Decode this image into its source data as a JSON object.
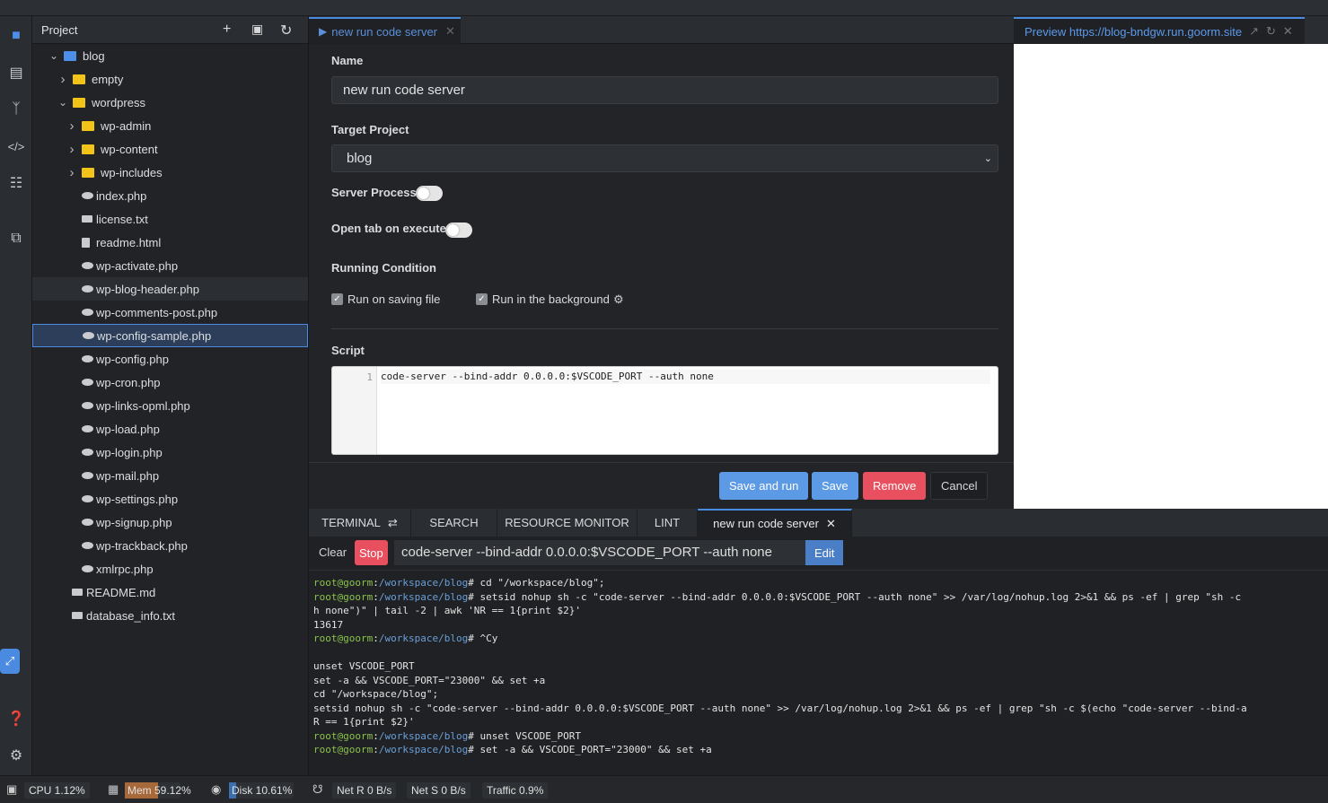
{
  "tree": {
    "title": "Project",
    "items": [
      {
        "label": "blog",
        "depth": 0,
        "type": "folder-root",
        "expanded": true
      },
      {
        "label": "empty",
        "depth": 1,
        "type": "folder",
        "expanded": false
      },
      {
        "label": "wordpress",
        "depth": 1,
        "type": "folder",
        "expanded": true
      },
      {
        "label": "wp-admin",
        "depth": 2,
        "type": "folder",
        "expanded": false
      },
      {
        "label": "wp-content",
        "depth": 2,
        "type": "folder",
        "expanded": false
      },
      {
        "label": "wp-includes",
        "depth": 2,
        "type": "folder",
        "expanded": false
      },
      {
        "label": "index.php",
        "depth": 2,
        "type": "php"
      },
      {
        "label": "license.txt",
        "depth": 2,
        "type": "txt"
      },
      {
        "label": "readme.html",
        "depth": 2,
        "type": "html"
      },
      {
        "label": "wp-activate.php",
        "depth": 2,
        "type": "php"
      },
      {
        "label": "wp-blog-header.php",
        "depth": 2,
        "type": "php",
        "state": "hover"
      },
      {
        "label": "wp-comments-post.php",
        "depth": 2,
        "type": "php"
      },
      {
        "label": "wp-config-sample.php",
        "depth": 2,
        "type": "php",
        "state": "selected"
      },
      {
        "label": "wp-config.php",
        "depth": 2,
        "type": "php"
      },
      {
        "label": "wp-cron.php",
        "depth": 2,
        "type": "php"
      },
      {
        "label": "wp-links-opml.php",
        "depth": 2,
        "type": "php"
      },
      {
        "label": "wp-load.php",
        "depth": 2,
        "type": "php"
      },
      {
        "label": "wp-login.php",
        "depth": 2,
        "type": "php"
      },
      {
        "label": "wp-mail.php",
        "depth": 2,
        "type": "php"
      },
      {
        "label": "wp-settings.php",
        "depth": 2,
        "type": "php"
      },
      {
        "label": "wp-signup.php",
        "depth": 2,
        "type": "php"
      },
      {
        "label": "wp-trackback.php",
        "depth": 2,
        "type": "php"
      },
      {
        "label": "xmlrpc.php",
        "depth": 2,
        "type": "php"
      },
      {
        "label": "README.md",
        "depth": 1,
        "type": "txt"
      },
      {
        "label": "database_info.txt",
        "depth": 1,
        "type": "txt"
      }
    ]
  },
  "editor_tab": {
    "label": "new run code server"
  },
  "form": {
    "name_label": "Name",
    "name_value": "new run code server",
    "target_label": "Target Project",
    "target_value": "blog",
    "server_process_label": "Server Process",
    "server_process_on": false,
    "open_tab_label": "Open tab on execute",
    "open_tab_on": false,
    "running_condition_label": "Running Condition",
    "run_on_saving": "Run on saving file",
    "run_background": "Run in the background",
    "script_label": "Script",
    "script_line_no": "1",
    "script_code": "code-server --bind-addr 0.0.0.0:$VSCODE_PORT --auth none",
    "save_and_run": "Save and run",
    "save": "Save",
    "remove": "Remove",
    "cancel": "Cancel"
  },
  "preview": {
    "label": "Preview https://blog-bndgw.run.goorm.site"
  },
  "bottom_tabs": [
    "TERMINAL",
    "SEARCH",
    "RESOURCE MONITOR",
    "LINT",
    "new run code server"
  ],
  "runbar": {
    "clear": "Clear",
    "stop": "Stop",
    "command": "code-server --bind-addr 0.0.0.0:$VSCODE_PORT --auth none",
    "edit": "Edit"
  },
  "terminal": {
    "prompt_user": "root@goorm",
    "prompt_path": "/workspace/blog",
    "lines": [
      {
        "p": true,
        "t": " cd \"/workspace/blog\";"
      },
      {
        "p": true,
        "t": " setsid nohup sh -c \"code-server --bind-addr 0.0.0.0:$VSCODE_PORT --auth none\" >> /var/log/nohup.log 2>&1 && ps -ef | grep \"sh -c"
      },
      {
        "p": false,
        "t": "h none\")\" | tail -2 | awk 'NR == 1{print $2}'"
      },
      {
        "p": false,
        "t": "13617"
      },
      {
        "p": true,
        "t": " ^Cy"
      },
      {
        "p": false,
        "t": ""
      },
      {
        "p": false,
        "t": "unset VSCODE_PORT"
      },
      {
        "p": false,
        "t": "set -a && VSCODE_PORT=\"23000\" && set +a"
      },
      {
        "p": false,
        "t": "cd \"/workspace/blog\";"
      },
      {
        "p": false,
        "t": "setsid nohup sh -c \"code-server --bind-addr 0.0.0.0:$VSCODE_PORT --auth none\" >> /var/log/nohup.log 2>&1 && ps -ef | grep \"sh -c $(echo \"code-server --bind-a"
      },
      {
        "p": false,
        "t": "R == 1{print $2}'"
      },
      {
        "p": true,
        "t": " unset VSCODE_PORT"
      },
      {
        "p": true,
        "t": " set -a && VSCODE_PORT=\"23000\" && set +a"
      }
    ]
  },
  "status": {
    "cpu": "CPU 1.12%",
    "mem": "Mem 59.12%",
    "mem_fraction": 0.5912,
    "disk": "Disk 10.61%",
    "disk_fraction": 0.1061,
    "net_r": "Net R 0 B/s",
    "net_s": "Net S 0 B/s",
    "traffic": "Traffic 0.9%"
  },
  "colors": {
    "accent": "#4a8ae0",
    "danger": "#e8505f",
    "primary": "#5c9ae6",
    "mem": "#a8693a"
  }
}
